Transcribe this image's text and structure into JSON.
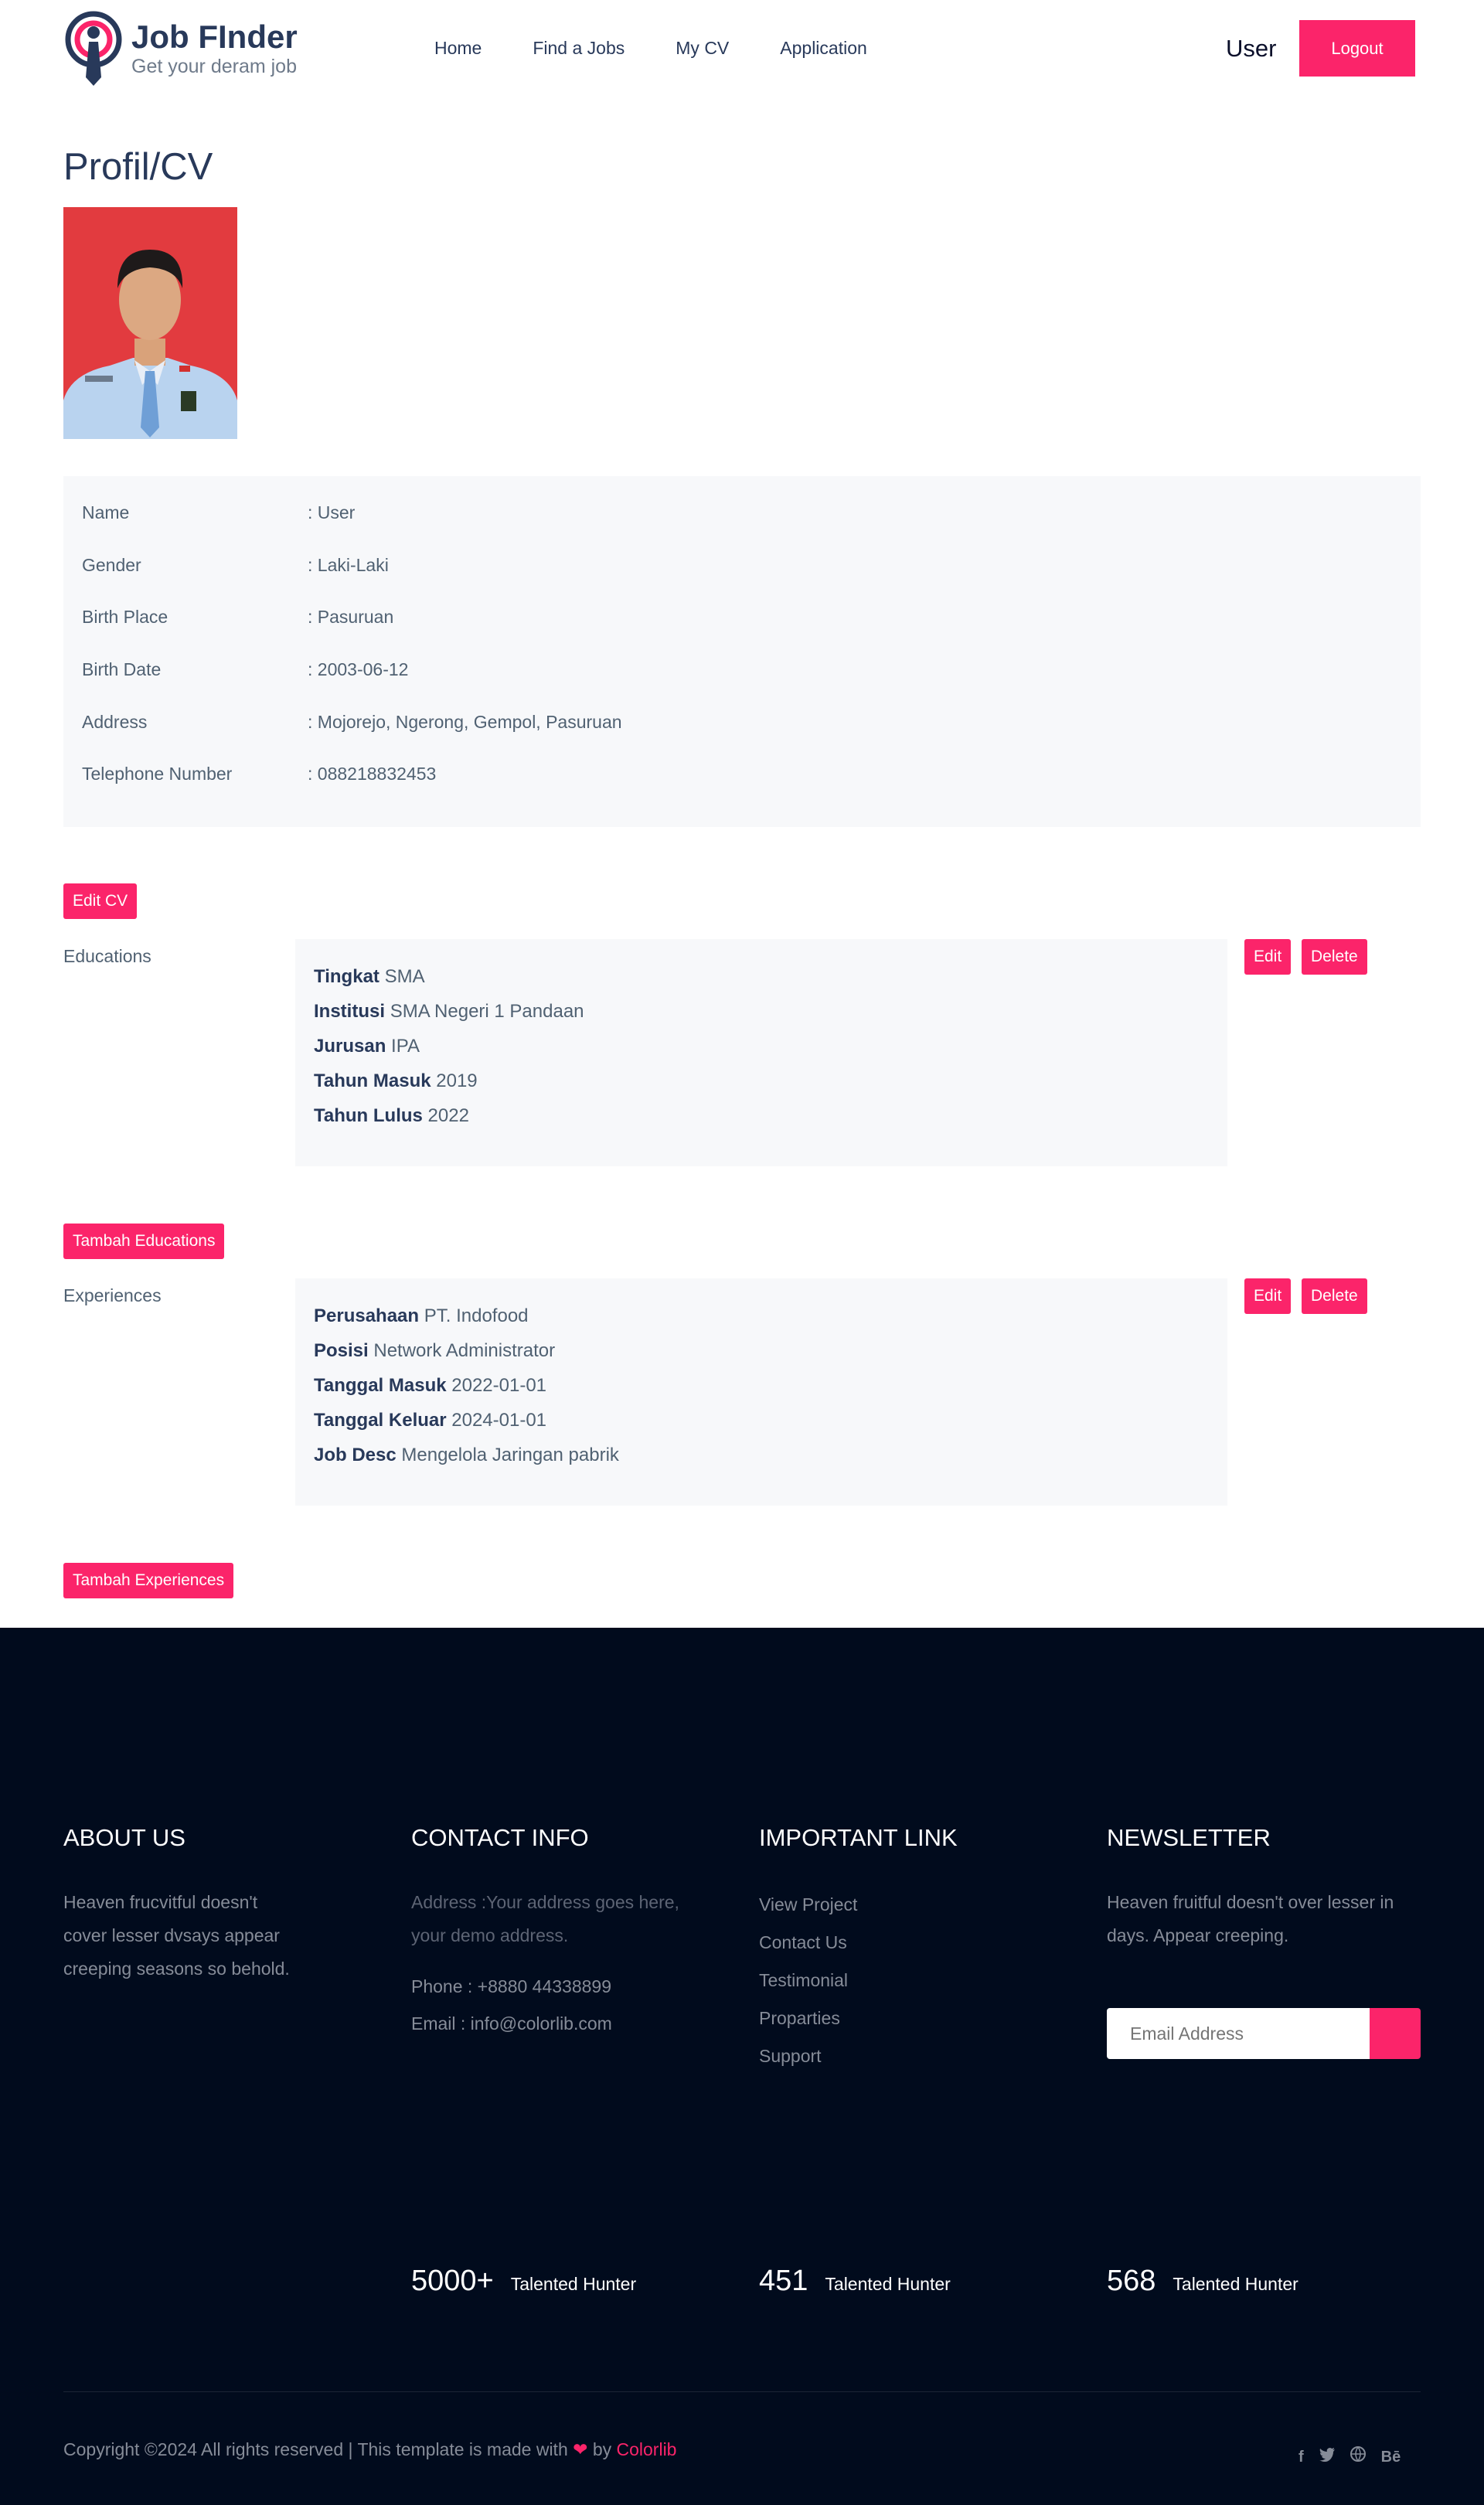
{
  "header": {
    "logo_title": "Job FInder",
    "logo_subtitle": "Get your deram job",
    "nav": [
      "Home",
      "Find a Jobs",
      "My CV",
      "Application"
    ],
    "user": "User",
    "logout": "Logout"
  },
  "profile": {
    "title": "Profil/CV",
    "fields": [
      {
        "label": "Name",
        "value": ": User"
      },
      {
        "label": "Gender",
        "value": ": Laki-Laki"
      },
      {
        "label": "Birth Place",
        "value": ": Pasuruan"
      },
      {
        "label": "Birth Date",
        "value": ": 2003-06-12"
      },
      {
        "label": "Address",
        "value": ": Mojorejo, Ngerong, Gempol, Pasuruan"
      },
      {
        "label": "Telephone Number",
        "value": ": 088218832453"
      }
    ],
    "edit_cv": "Edit CV"
  },
  "educations": {
    "label": "Educations",
    "items": [
      {
        "k": "Tingkat",
        "v": "SMA"
      },
      {
        "k": "Institusi",
        "v": "SMA Negeri 1 Pandaan"
      },
      {
        "k": "Jurusan",
        "v": "IPA"
      },
      {
        "k": "Tahun Masuk",
        "v": "2019"
      },
      {
        "k": "Tahun Lulus",
        "v": "2022"
      }
    ],
    "edit": "Edit",
    "delete": "Delete",
    "add": "Tambah Educations"
  },
  "experiences": {
    "label": "Experiences",
    "items": [
      {
        "k": "Perusahaan",
        "v": "PT. Indofood"
      },
      {
        "k": "Posisi",
        "v": "Network Administrator"
      },
      {
        "k": "Tanggal Masuk",
        "v": "2022-01-01"
      },
      {
        "k": "Tanggal Keluar",
        "v": "2024-01-01"
      },
      {
        "k": "Job Desc",
        "v": "Mengelola Jaringan pabrik"
      }
    ],
    "edit": "Edit",
    "delete": "Delete",
    "add": "Tambah Experiences"
  },
  "footer": {
    "about_head": "ABOUT US",
    "about_text": [
      "Heaven frucvitful doesn't",
      "cover lesser dvsays appear",
      "creeping seasons so behold."
    ],
    "contact_head": "CONTACT INFO",
    "contact_address": [
      "Address :Your address goes here,",
      "your demo address."
    ],
    "contact_phone": "Phone : +8880 44338899",
    "contact_email": "Email : info@colorlib.com",
    "links_head": "IMPORTANT LINK",
    "links": [
      "View Project",
      "Contact Us",
      "Testimonial",
      "Proparties",
      "Support"
    ],
    "news_head": "NEWSLETTER",
    "news_text": [
      "Heaven fruitful doesn't over lesser in",
      "days. Appear creeping."
    ],
    "news_placeholder": "Email Address",
    "stats": [
      {
        "num": "5000+",
        "cap": "Talented Hunter"
      },
      {
        "num": "451",
        "cap": "Talented Hunter"
      },
      {
        "num": "568",
        "cap": "Talented Hunter"
      }
    ],
    "copyright_pre": "Copyright ©2024 All rights reserved | This template is made with",
    "copyright_by": "by",
    "copyright_brand": "Colorlib",
    "socials": [
      "f",
      "t",
      "g",
      "Bē"
    ]
  },
  "colors": {
    "accent": "#fb246a",
    "footer_bg": "#010b1d",
    "heading": "#28395a"
  }
}
